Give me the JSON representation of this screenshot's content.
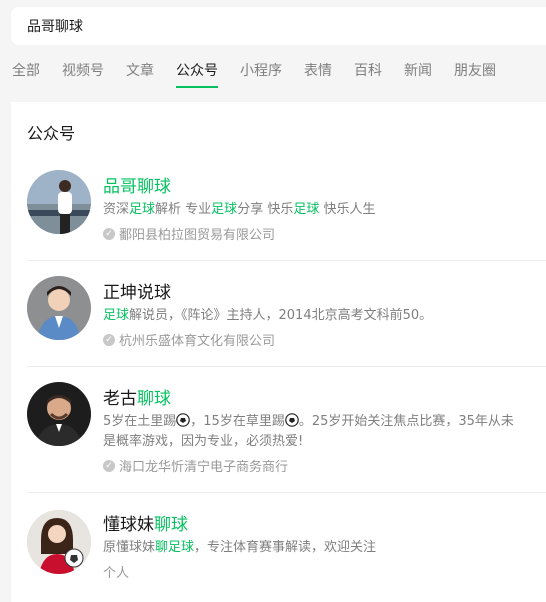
{
  "search": {
    "query": "品哥聊球"
  },
  "tabs": [
    {
      "label": "全部",
      "active": false
    },
    {
      "label": "视频号",
      "active": false
    },
    {
      "label": "文章",
      "active": false
    },
    {
      "label": "公众号",
      "active": true
    },
    {
      "label": "小程序",
      "active": false
    },
    {
      "label": "表情",
      "active": false
    },
    {
      "label": "百科",
      "active": false
    },
    {
      "label": "新闻",
      "active": false
    },
    {
      "label": "朋友圈",
      "active": false
    }
  ],
  "section_title": "公众号",
  "accounts": [
    {
      "name_parts": [
        {
          "text": "品哥聊球",
          "hl": true
        }
      ],
      "desc_lines": [
        [
          {
            "text": "资深",
            "hl": false
          },
          {
            "text": "足球",
            "hl": true
          },
          {
            "text": "解析 专业",
            "hl": false
          },
          {
            "text": "足球",
            "hl": true
          },
          {
            "text": "分享 快乐",
            "hl": false
          },
          {
            "text": "足球",
            "hl": true
          },
          {
            "text": " 快乐人生",
            "hl": false
          }
        ]
      ],
      "org": "鄱阳县柏拉图贸易有限公司",
      "org_verified": true,
      "avatar_icon": "avatar-man-stadium"
    },
    {
      "name_parts": [
        {
          "text": "正坤说球",
          "hl": false
        }
      ],
      "desc_lines": [
        [
          {
            "text": "足球",
            "hl": true
          },
          {
            "text": "解说员，《阵论》主持人，2014北京高考文科前50。",
            "hl": false
          }
        ]
      ],
      "org": "杭州乐盛体育文化有限公司",
      "org_verified": true,
      "avatar_icon": "avatar-man-suit"
    },
    {
      "name_parts": [
        {
          "text": "老古",
          "hl": false
        },
        {
          "text": "聊球",
          "hl": true
        }
      ],
      "desc_lines": [
        [
          {
            "text": "5岁在土里踢",
            "hl": false
          },
          {
            "text": "⚽",
            "hl": false,
            "ball": true
          },
          {
            "text": "，15岁在草里踢",
            "hl": false
          },
          {
            "text": "⚽",
            "hl": false,
            "ball": true
          },
          {
            "text": "。25岁开始关注焦点比赛，35年从未",
            "hl": false
          }
        ],
        [
          {
            "text": "是概率游戏，因为专业，必须热爱!",
            "hl": false
          }
        ]
      ],
      "org": "海口龙华忻清宁电子商务商行",
      "org_verified": true,
      "avatar_icon": "avatar-man-dark"
    },
    {
      "name_parts": [
        {
          "text": "懂球妹",
          "hl": false
        },
        {
          "text": "聊球",
          "hl": true
        }
      ],
      "desc_lines": [
        [
          {
            "text": "原懂球妹",
            "hl": false
          },
          {
            "text": "聊足球",
            "hl": true
          },
          {
            "text": "，专注体育赛事解读，欢迎关注",
            "hl": false
          }
        ]
      ],
      "org": "个人",
      "org_verified": false,
      "avatar_icon": "avatar-woman-ball"
    }
  ],
  "colors": {
    "accent": "#07c160",
    "muted": "#7f7f7f",
    "bg": "#f5f5f5"
  }
}
